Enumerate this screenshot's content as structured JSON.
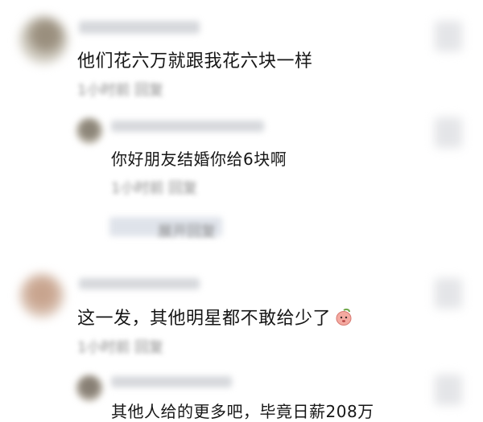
{
  "comments": [
    {
      "text": "他们花六万就跟我花六块一样",
      "meta": "1小时前 回复",
      "replies": [
        {
          "text": "你好朋友结婚你给6块啊",
          "meta": "1小时前 回复"
        }
      ],
      "more_meta": "展开回复"
    },
    {
      "text": "这一发，其他明星都不敢给少了",
      "emoji": "peach-face-icon",
      "meta": "1小时前 回复",
      "replies": [
        {
          "text": "其他人给的更多吧，毕竟日薪208万",
          "meta": ""
        }
      ]
    }
  ]
}
